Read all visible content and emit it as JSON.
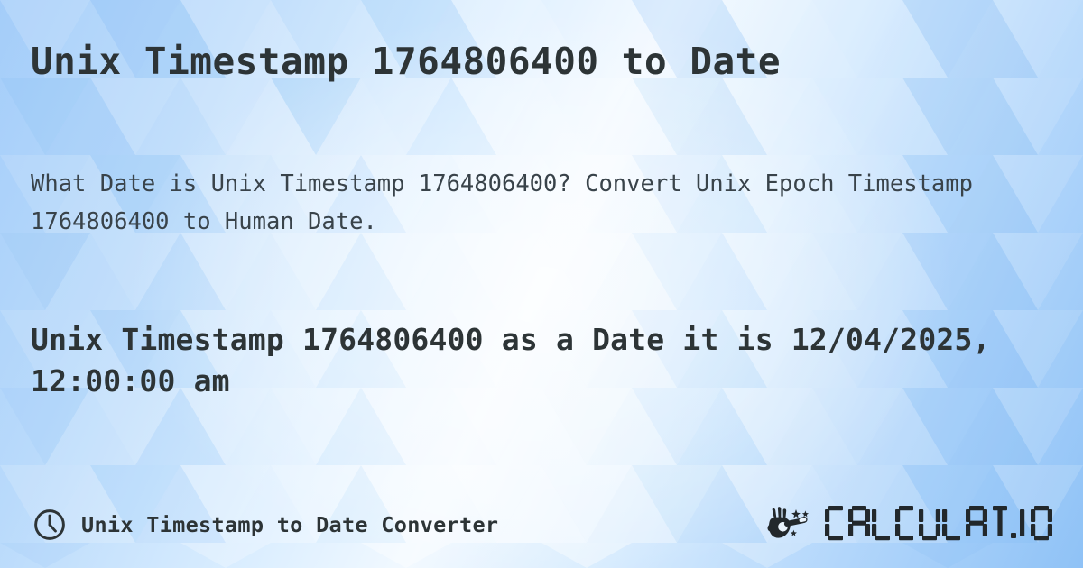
{
  "page": {
    "title": "Unix Timestamp 1764806400 to Date",
    "description": "What Date is Unix Timestamp 1764806400? Convert Unix Epoch Timestamp 1764806400 to Human Date.",
    "result": "Unix Timestamp 1764806400 as a Date it is 12/04/2025, 12:00:00 am",
    "timestamp": "1764806400",
    "human_date": "12/04/2025, 12:00:00 am"
  },
  "footer": {
    "clock_icon": "clock-icon",
    "label": "Unix Timestamp to Date Converter",
    "brand": {
      "wand_icon": "magic-wand-hand-icon",
      "name": "CALCULAT.IO"
    }
  },
  "colors": {
    "heading_text": "#2d3436",
    "body_text": "#39434a",
    "background_light": "#f2f9ff",
    "background_mid": "#b9dafb",
    "background_deep": "#8fc2f6",
    "logo_dark": "#22282c"
  }
}
